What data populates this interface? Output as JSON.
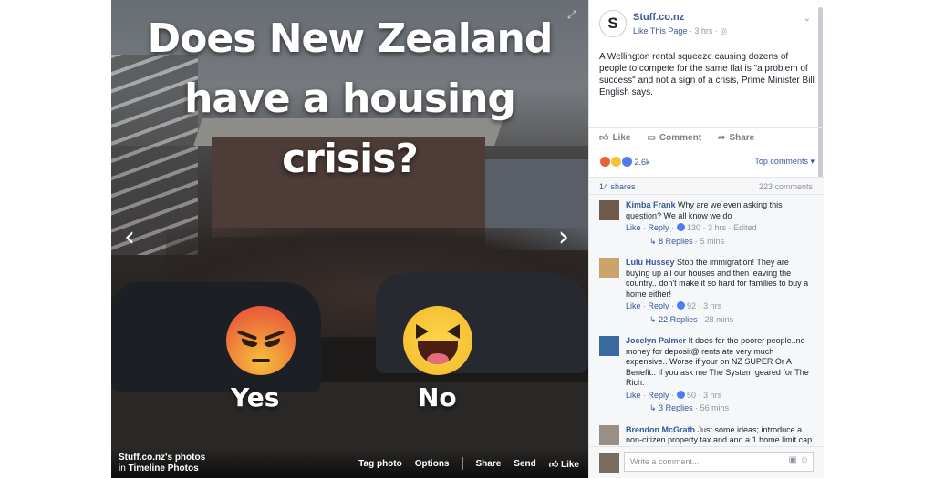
{
  "photo": {
    "headline_lines": [
      "Does New Zealand",
      "have a housing",
      "crisis?"
    ],
    "options": [
      "Yes",
      "No"
    ],
    "album_owner": "Stuff.co.nz's photos",
    "album_prefix": "in",
    "album_name": "Timeline Photos",
    "actions": [
      "Tag photo",
      "Options",
      "Share",
      "Send",
      "Like"
    ]
  },
  "post": {
    "page_name": "Stuff.co.nz",
    "logo_letter": "S",
    "like_page": "Like This Page",
    "time": "3 hrs",
    "text": "A Wellington rental squeeze causing dozens of people to compete for the same flat is \"a problem of success\" and not a sign of a crisis, Prime Minister Bill English says.",
    "action_like": "Like",
    "action_comment": "Comment",
    "action_share": "Share",
    "reaction_count": "2.6k",
    "top_comments": "Top comments",
    "shares": "14 shares",
    "comment_count": "223 comments"
  },
  "comments": [
    {
      "author": "Kimba Frank",
      "text": "Why are we even asking this question? We all know we do",
      "like": "Like",
      "reply": "Reply",
      "likes": "130",
      "time": "3 hrs",
      "edited": "Edited",
      "replies": "8 Replies",
      "replies_time": "5 mins"
    },
    {
      "author": "Lulu Hussey",
      "text": "Stop the immigration! They are buying up all our houses and then leaving the country.. don't make it so hard for families to buy a home either!",
      "like": "Like",
      "reply": "Reply",
      "likes": "92",
      "time": "3 hrs",
      "edited": "",
      "replies": "22 Replies",
      "replies_time": "28 mins"
    },
    {
      "author": "Jocelyn Palmer",
      "text": "It does for the poorer people..no money for deposit@ rents ate very much expensive.. Worse if your on NZ SUPER Or A Benefit.. If you ask me The System geared for The Rich.",
      "like": "Like",
      "reply": "Reply",
      "likes": "50",
      "time": "3 hrs",
      "edited": "",
      "replies": "3 Replies",
      "replies_time": "56 mins"
    },
    {
      "author": "Brendon McGrath",
      "text": "Just some ideas; introduce a non-citizen property tax and and a 1 home limit cap.",
      "like": "",
      "reply": "",
      "likes": "",
      "time": "",
      "edited": "",
      "replies": "",
      "replies_time": ""
    }
  ],
  "write_placeholder": "Write a comment...",
  "icons": [
    "expand-icon",
    "chevron-left-icon",
    "chevron-right-icon",
    "globe-icon",
    "like-icon",
    "comment-icon",
    "share-icon",
    "camera-icon",
    "emoji-icon"
  ]
}
